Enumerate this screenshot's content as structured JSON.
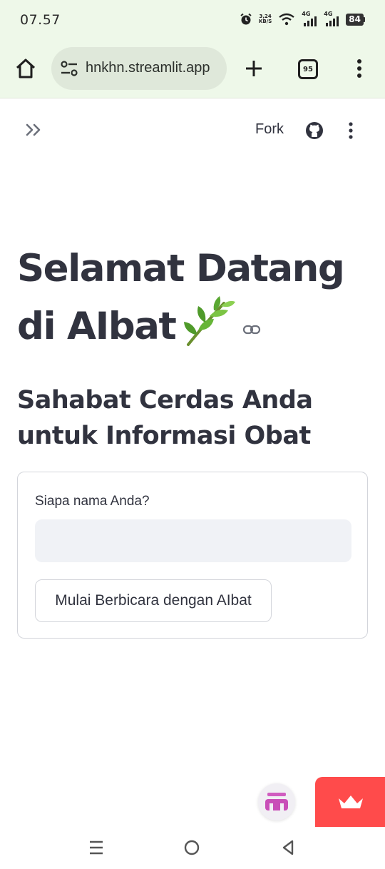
{
  "status_bar": {
    "time": "07.57",
    "net_speed_value": "3,24",
    "net_speed_unit": "KB/S",
    "network_1": "4G",
    "network_2": "4G",
    "battery": "84"
  },
  "browser": {
    "url": "hnkhn.streamlit.app",
    "tab_count": "95"
  },
  "app_header": {
    "fork_label": "Fork"
  },
  "main": {
    "title_line1": "Selamat Datang",
    "title_line2": "di AIbat",
    "subtitle_line1": "Sahabat Cerdas Anda",
    "subtitle_line2": "untuk Informasi Obat",
    "form": {
      "name_label": "Siapa nama Anda?",
      "name_value": "",
      "name_placeholder": "",
      "submit_label": "Mulai Berbicara dengan AIbat"
    }
  },
  "icons": {
    "leaf": "herb-emoji-icon",
    "anchor": "link-icon",
    "github": "github-icon",
    "streamlit_badge": "crown-icon"
  },
  "colors": {
    "chrome_bg": "#eef8e9",
    "text_dark": "#31333f",
    "input_bg": "#f0f2f6",
    "streamlit_red": "#ff4b4b"
  }
}
